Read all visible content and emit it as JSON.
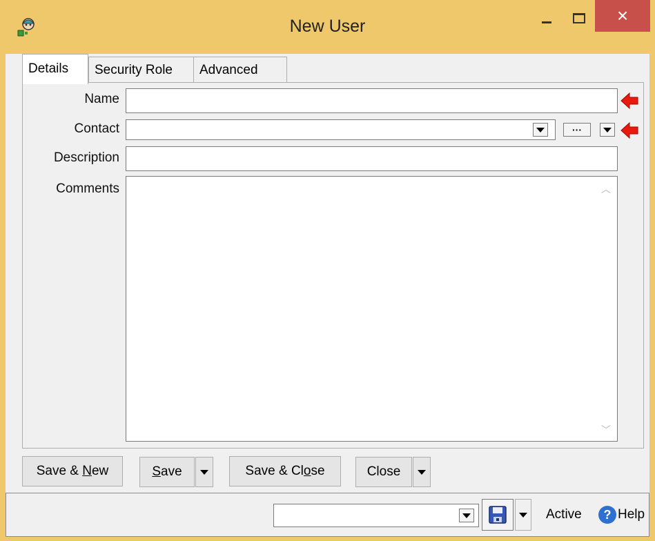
{
  "window": {
    "title": "New User",
    "close_glyph": "×"
  },
  "tabs": [
    {
      "label": "Details",
      "active": true
    },
    {
      "label": "Security Role",
      "active": false
    },
    {
      "label": "Advanced",
      "active": false
    }
  ],
  "form": {
    "name": {
      "label": "Name",
      "value": "",
      "required": true
    },
    "contact": {
      "label": "Contact",
      "value": "",
      "required": true,
      "more_glyph": "···"
    },
    "description": {
      "label": "Description",
      "value": ""
    },
    "comments": {
      "label": "Comments",
      "value": ""
    }
  },
  "buttons": {
    "save_new": {
      "pre": "Save & ",
      "mnemonic": "N",
      "post": "ew"
    },
    "save": {
      "pre": "",
      "mnemonic": "S",
      "post": "ave"
    },
    "save_close": {
      "pre": "Save & Cl",
      "mnemonic": "o",
      "post": "se"
    },
    "close": {
      "label": "Close"
    }
  },
  "status": {
    "selector_value": "",
    "active_label": "Active",
    "help_label": "Help",
    "help_glyph": "?"
  },
  "icons": {
    "app": "user-group-icon",
    "required": "red-arrow-left-icon",
    "save": "floppy-disk-icon",
    "help": "help-circle-icon"
  },
  "colors": {
    "titlebar": "#efc86b",
    "close_button": "#c7504a",
    "required_arrow": "#e8190f",
    "help_icon": "#2e6fd2"
  }
}
